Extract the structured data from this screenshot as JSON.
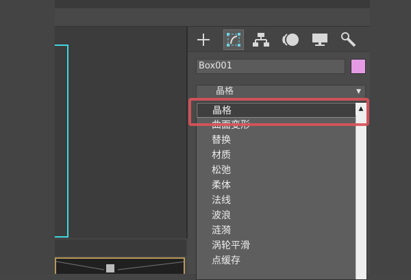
{
  "object_name": "Box001",
  "colors": {
    "object_color": "#e49be4",
    "selection": "#40d8e0",
    "highlight": "#d9545a"
  },
  "tabs": [
    {
      "name": "create-tab",
      "icon": "plus-icon"
    },
    {
      "name": "modify-tab",
      "icon": "modify-icon",
      "active": true
    },
    {
      "name": "hierarchy-tab",
      "icon": "hierarchy-icon"
    },
    {
      "name": "motion-tab",
      "icon": "motion-icon"
    },
    {
      "name": "display-tab",
      "icon": "display-icon"
    },
    {
      "name": "utilities-tab",
      "icon": "wrench-icon"
    }
  ],
  "modifier_list": {
    "selected": "晶格",
    "items": [
      "晶格",
      "曲面变形",
      "替换",
      "材质",
      "松弛",
      "柔体",
      "法线",
      "波浪",
      "涟漪",
      "涡轮平滑",
      "点缓存"
    ]
  }
}
